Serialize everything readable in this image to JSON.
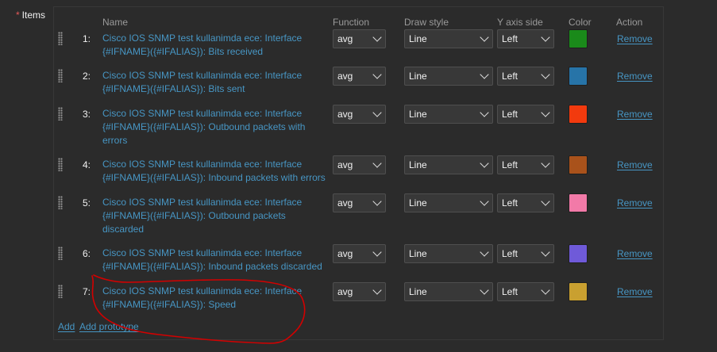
{
  "field": {
    "required_mark": "*",
    "label": "Items"
  },
  "columns": {
    "name": "Name",
    "function": "Function",
    "draw_style": "Draw style",
    "y_axis_side": "Y axis side",
    "color": "Color",
    "action": "Action"
  },
  "items": [
    {
      "num": "1:",
      "name": "Cisco IOS SNMP test kullanimda ece: Interface {#IFNAME}({#IFALIAS}): Bits received",
      "function": "avg",
      "draw_style": "Line",
      "y_axis_side": "Left",
      "color": "#1a8a1a",
      "action": "Remove"
    },
    {
      "num": "2:",
      "name": "Cisco IOS SNMP test kullanimda ece: Interface {#IFNAME}({#IFALIAS}): Bits sent",
      "function": "avg",
      "draw_style": "Line",
      "y_axis_side": "Left",
      "color": "#2774a8",
      "action": "Remove"
    },
    {
      "num": "3:",
      "name": "Cisco IOS SNMP test kullanimda ece: Interface {#IFNAME}({#IFALIAS}): Outbound packets with errors",
      "function": "avg",
      "draw_style": "Line",
      "y_axis_side": "Left",
      "color": "#f23a0e",
      "action": "Remove"
    },
    {
      "num": "4:",
      "name": "Cisco IOS SNMP test kullanimda ece: Interface {#IFNAME}({#IFALIAS}): Inbound packets with errors",
      "function": "avg",
      "draw_style": "Line",
      "y_axis_side": "Left",
      "color": "#a9521b",
      "action": "Remove"
    },
    {
      "num": "5:",
      "name": "Cisco IOS SNMP test kullanimda ece: Interface {#IFNAME}({#IFALIAS}): Outbound packets discarded",
      "function": "avg",
      "draw_style": "Line",
      "y_axis_side": "Left",
      "color": "#f27aa8",
      "action": "Remove"
    },
    {
      "num": "6:",
      "name": "Cisco IOS SNMP test kullanimda ece: Interface {#IFNAME}({#IFALIAS}): Inbound packets discarded",
      "function": "avg",
      "draw_style": "Line",
      "y_axis_side": "Left",
      "color": "#6f5ad9",
      "action": "Remove"
    },
    {
      "num": "7:",
      "name": "Cisco IOS SNMP test kullanimda ece: Interface {#IFNAME}({#IFALIAS}): Speed",
      "function": "avg",
      "draw_style": "Line",
      "y_axis_side": "Left",
      "color": "#c9a030",
      "action": "Remove"
    }
  ],
  "footer": {
    "add": "Add",
    "add_prototype": "Add prototype"
  },
  "annotation_color": "#d40000"
}
